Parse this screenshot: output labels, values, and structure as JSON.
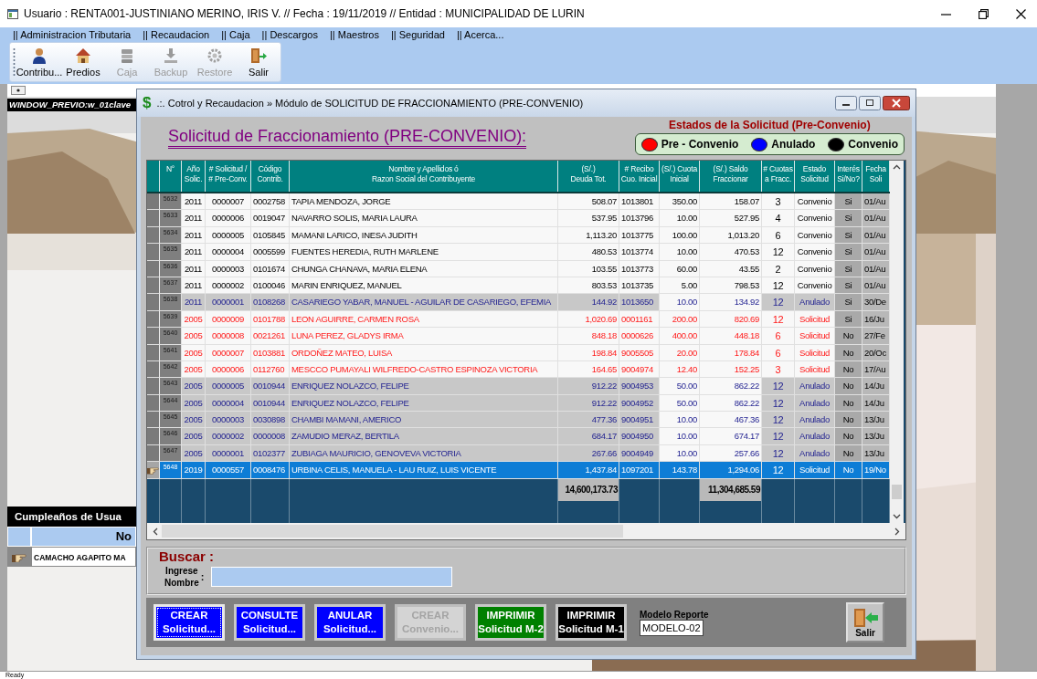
{
  "window": {
    "title": "Usuario : RENTA001-JUSTINIANO MERINO, IRIS V. // Fecha : 19/11/2019 // Entidad : MUNICIPALIDAD DE LURIN"
  },
  "menu": [
    "|| Administracion Tributaria",
    "|| Recaudacion",
    "|| Caja",
    "|| Descargos",
    "|| Maestros",
    "|| Seguridad",
    "|| Acerca..."
  ],
  "toolbar": [
    {
      "label": "Contribu...",
      "kind": "person",
      "disabled": false
    },
    {
      "label": "Predios",
      "kind": "house",
      "disabled": false
    },
    {
      "label": "Caja",
      "kind": "stack",
      "disabled": true
    },
    {
      "label": "Backup",
      "kind": "download",
      "disabled": true
    },
    {
      "label": "Restore",
      "kind": "gear",
      "disabled": true
    },
    {
      "label": "Salir",
      "kind": "door",
      "disabled": false
    }
  ],
  "background_window": {
    "title": "WINDOW_PREVIO:w_01clave",
    "birthdays": {
      "title": "Cumpleaños de Usua",
      "column_1": "No",
      "rows": [
        "CAMACHO AGAPITO MA"
      ]
    }
  },
  "dialog": {
    "icon": "$",
    "title": ".:. Cotrol y Recaudacion » Módulo de SOLICITUD DE FRACCIONAMIENTO (PRE-CONVENIO)",
    "heading": "Solicitud de Fraccionamiento (PRE-CONVENIO):",
    "legend": {
      "title": "Estados de la Solicitud (Pre-Convenio)",
      "items": [
        {
          "label": "Pre - Convenio",
          "color": "#ff0000"
        },
        {
          "label": "Anulado",
          "color": "#0000ff"
        },
        {
          "label": "Convenio",
          "color": "#000000"
        }
      ]
    },
    "table": {
      "columns": [
        {
          "label": "N°"
        },
        {
          "label": "Año\nSolic."
        },
        {
          "label": "# Solicitud /\n# Pre-Conv."
        },
        {
          "label": "Código\nContrib."
        },
        {
          "label": "Nombre y Apellidos ó\nRazon Social del Contribuyente"
        },
        {
          "label": "(S/.)\nDeuda Tot.",
          "total": "14,600,173.73"
        },
        {
          "label": "# Recibo\nCuo. Inicial"
        },
        {
          "label": "(S/.) Cuota\nInicial"
        },
        {
          "label": "(S/.) Saldo\nFraccionar",
          "total": "11,304,685.59"
        },
        {
          "label": "# Cuotas\na Fracc."
        },
        {
          "label": "Estado\nSolicitud"
        },
        {
          "label": "Interés\nSi/No?"
        },
        {
          "label": "Fecha\nSoli"
        }
      ],
      "rows": [
        {
          "kind": "convenio",
          "selected": false,
          "cells": [
            "5632",
            "2011",
            "0000007",
            "0002758",
            "TAPIA MENDOZA, JORGE",
            "508.07",
            "1013801",
            "350.00",
            "158.07",
            "3",
            "Convenio",
            "Si",
            "01/Au"
          ]
        },
        {
          "kind": "convenio",
          "selected": false,
          "cells": [
            "5633",
            "2011",
            "0000006",
            "0019047",
            "NAVARRO SOLIS, MARIA LAURA",
            "537.95",
            "1013796",
            "10.00",
            "527.95",
            "4",
            "Convenio",
            "Si",
            "01/Au"
          ]
        },
        {
          "kind": "convenio",
          "selected": false,
          "cells": [
            "5634",
            "2011",
            "0000005",
            "0105845",
            "MAMANI LARICO, INESA JUDITH",
            "1,113.20",
            "1013775",
            "100.00",
            "1,013.20",
            "6",
            "Convenio",
            "Si",
            "01/Au"
          ]
        },
        {
          "kind": "convenio",
          "selected": false,
          "cells": [
            "5635",
            "2011",
            "0000004",
            "0005599",
            "FUENTES HEREDIA, RUTH MARLENE",
            "480.53",
            "1013774",
            "10.00",
            "470.53",
            "12",
            "Convenio",
            "Si",
            "01/Au"
          ]
        },
        {
          "kind": "convenio",
          "selected": false,
          "cells": [
            "5636",
            "2011",
            "0000003",
            "0101674",
            "CHUNGA CHANAVA, MARIA ELENA",
            "103.55",
            "1013773",
            "60.00",
            "43.55",
            "2",
            "Convenio",
            "Si",
            "01/Au"
          ]
        },
        {
          "kind": "convenio",
          "selected": false,
          "cells": [
            "5637",
            "2011",
            "0000002",
            "0100046",
            "MARIN ENRIQUEZ, MANUEL",
            "803.53",
            "1013735",
            "5.00",
            "798.53",
            "12",
            "Convenio",
            "Si",
            "01/Au"
          ]
        },
        {
          "kind": "anulado",
          "selected": false,
          "cells": [
            "5638",
            "2011",
            "0000001",
            "0108268",
            "CASARIEGO YABAR, MANUEL - AGUILAR DE CASARIEGO, EFEMIA",
            "144.92",
            "1013650",
            "10.00",
            "134.92",
            "12",
            "Anulado",
            "Si",
            "30/De"
          ]
        },
        {
          "kind": "solicitud",
          "selected": false,
          "cells": [
            "5639",
            "2005",
            "0000009",
            "0101788",
            "LEON AGUIRRE, CARMEN ROSA",
            "1,020.69",
            "0001161",
            "200.00",
            "820.69",
            "12",
            "Solicitud",
            "Si",
            "16/Ju"
          ]
        },
        {
          "kind": "solicitud",
          "selected": false,
          "cells": [
            "5640",
            "2005",
            "0000008",
            "0021261",
            "LUNA PEREZ, GLADYS IRMA",
            "848.18",
            "0000626",
            "400.00",
            "448.18",
            "6",
            "Solicitud",
            "No",
            "27/Fe"
          ]
        },
        {
          "kind": "solicitud",
          "selected": false,
          "cells": [
            "5641",
            "2005",
            "0000007",
            "0103881",
            "ORDOÑEZ MATEO, LUISA",
            "198.84",
            "9005505",
            "20.00",
            "178.84",
            "6",
            "Solicitud",
            "No",
            "20/Oc"
          ]
        },
        {
          "kind": "solicitud",
          "selected": false,
          "cells": [
            "5642",
            "2005",
            "0000006",
            "0112760",
            "MESCCO PUMAYALI WILFREDO-CASTRO ESPINOZA VICTORIA",
            "164.65",
            "9004974",
            "12.40",
            "152.25",
            "3",
            "Solicitud",
            "No",
            "17/Au"
          ]
        },
        {
          "kind": "anulado",
          "selected": false,
          "cells": [
            "5643",
            "2005",
            "0000005",
            "0010944",
            "ENRIQUEZ NOLAZCO, FELIPE",
            "912.22",
            "9004953",
            "50.00",
            "862.22",
            "12",
            "Anulado",
            "No",
            "14/Ju"
          ]
        },
        {
          "kind": "anulado",
          "selected": false,
          "cells": [
            "5644",
            "2005",
            "0000004",
            "0010944",
            "ENRIQUEZ NOLAZCO, FELIPE",
            "912.22",
            "9004952",
            "50.00",
            "862.22",
            "12",
            "Anulado",
            "No",
            "14/Ju"
          ]
        },
        {
          "kind": "anulado",
          "selected": false,
          "cells": [
            "5645",
            "2005",
            "0000003",
            "0030898",
            "CHAMBI MAMANI, AMERICO",
            "477.36",
            "9004951",
            "10.00",
            "467.36",
            "12",
            "Anulado",
            "No",
            "13/Ju"
          ]
        },
        {
          "kind": "anulado",
          "selected": false,
          "cells": [
            "5646",
            "2005",
            "0000002",
            "0000008",
            "ZAMUDIO MERAZ, BERTILA",
            "684.17",
            "9004950",
            "10.00",
            "674.17",
            "12",
            "Anulado",
            "No",
            "13/Ju"
          ]
        },
        {
          "kind": "anulado",
          "selected": false,
          "cells": [
            "5647",
            "2005",
            "0000001",
            "0102377",
            "ZUBIAGA MAURICIO, GENOVEVA VICTORIA",
            "267.66",
            "9004949",
            "10.00",
            "257.66",
            "12",
            "Anulado",
            "No",
            "13/Ju"
          ]
        },
        {
          "kind": "solicitud",
          "selected": true,
          "cells": [
            "5648",
            "2019",
            "0000557",
            "0008476",
            "URBINA CELIS, MANUELA - LAU RUIZ, LUIS VICENTE",
            "1,437.84",
            "1097201",
            "143.78",
            "1,294.06",
            "12",
            "Solicitud",
            "No",
            "19/No"
          ]
        }
      ]
    },
    "search": {
      "title": "Buscar :",
      "label": "Ingrese\nNombre",
      "colon": ":"
    },
    "buttons": [
      {
        "line1": "CREAR",
        "line2": "Solicitud...",
        "color": "#0000ff",
        "disabled": false,
        "focused": true
      },
      {
        "line1": "CONSULTE",
        "line2": "Solicitud...",
        "color": "#0000ff",
        "disabled": false,
        "focused": false
      },
      {
        "line1": "ANULAR",
        "line2": "Solicitud...",
        "color": "#0000ff",
        "disabled": false,
        "focused": false
      },
      {
        "line1": "CREAR",
        "line2": "Convenio...",
        "color": "#d4d4d4",
        "disabled": true,
        "focused": false
      },
      {
        "line1": "IMPRIMIR",
        "line2": "Solicitud M-2",
        "color": "#008000",
        "disabled": false,
        "focused": false
      },
      {
        "line1": "IMPRIMIR",
        "line2": "Solicitud M-1",
        "color": "#000000",
        "disabled": false,
        "focused": false
      }
    ],
    "report_model": {
      "label": "Modelo Reporte",
      "value": "MODELO-02"
    },
    "exit_button": {
      "label": "Salir"
    }
  },
  "status_bar": "Ready"
}
